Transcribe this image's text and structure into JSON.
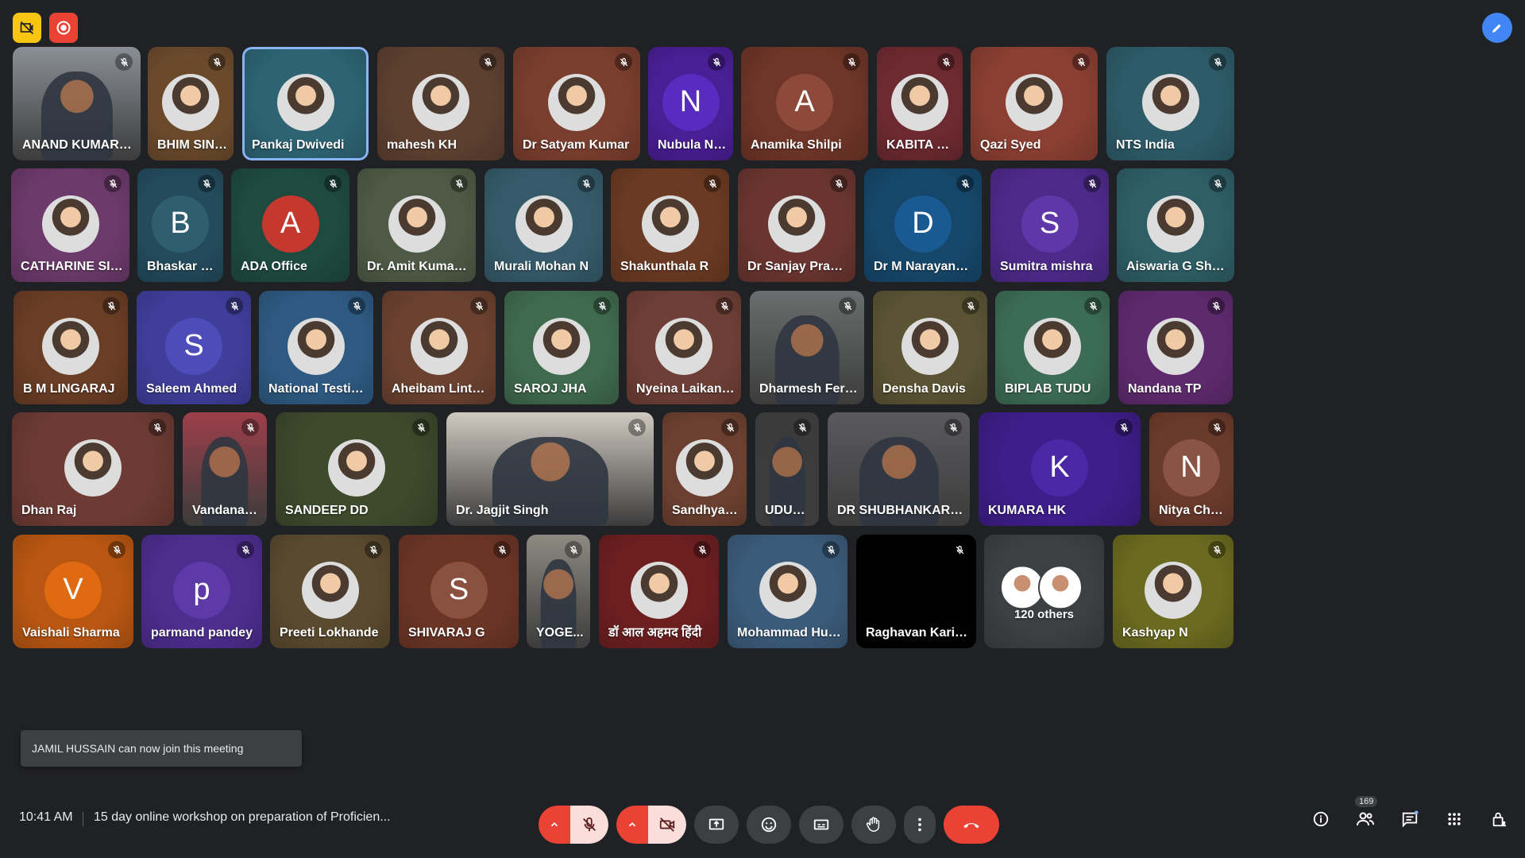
{
  "participants": [
    {
      "name": "ANAND KUMAR SAU...",
      "initial": "",
      "bg": "#8a8f96",
      "avatar": "photo-video",
      "muted": true
    },
    {
      "name": "BHIM SINGH",
      "initial": "",
      "bg": "#6b4a2c",
      "avatar": "photo",
      "muted": true
    },
    {
      "name": "Pankaj Dwivedi",
      "initial": "",
      "bg": "#2d6373",
      "avatar": "photo",
      "muted": false,
      "active": true
    },
    {
      "name": "mahesh KH",
      "initial": "",
      "bg": "#5d4030",
      "avatar": "photo",
      "muted": true
    },
    {
      "name": "Dr Satyam Kumar",
      "initial": "",
      "bg": "#7a3e2e",
      "avatar": "photo",
      "muted": true
    },
    {
      "name": "Nubula Nau...",
      "initial": "N",
      "bg": "#4a1e94",
      "avatarColor": "#5a2bbf",
      "muted": true
    },
    {
      "name": "Anamika Shilpi",
      "initial": "A",
      "bg": "#6e3528",
      "avatarColor": "#8d4a3a",
      "muted": true
    },
    {
      "name": "KABITA BA...",
      "initial": "",
      "bg": "#6d2a30",
      "avatar": "photo",
      "muted": true
    },
    {
      "name": "Qazi Syed",
      "initial": "",
      "bg": "#8b3f32",
      "avatar": "photo",
      "muted": true
    },
    {
      "name": "NTS India",
      "initial": "",
      "bg": "#2d5b68",
      "avatar": "photo",
      "muted": true
    },
    {
      "name": "CATHARINE SIBY",
      "initial": "",
      "bg": "#6c3a6b",
      "avatar": "photo",
      "muted": true
    },
    {
      "name": "Bhaskar Sin...",
      "initial": "B",
      "bg": "#234b5c",
      "avatarColor": "#2f5e70",
      "muted": true
    },
    {
      "name": "ADA Office",
      "initial": "A",
      "bg": "#1e4a40",
      "avatarColor": "#c5382e",
      "muted": true
    },
    {
      "name": "Dr. Amit Kumar Jha",
      "initial": "",
      "bg": "#4e5a45",
      "avatar": "photo",
      "muted": true
    },
    {
      "name": "Murali Mohan N",
      "initial": "",
      "bg": "#355b6a",
      "avatar": "photo",
      "muted": true
    },
    {
      "name": "Shakunthala R",
      "initial": "",
      "bg": "#6b3a22",
      "avatar": "photo",
      "muted": true
    },
    {
      "name": "Dr Sanjay Prasad S...",
      "initial": "",
      "bg": "#6a3530",
      "avatar": "photo",
      "muted": true
    },
    {
      "name": "Dr M Narayana Re...",
      "initial": "D",
      "bg": "#16476a",
      "avatarColor": "#1a5a92",
      "muted": true
    },
    {
      "name": "Sumitra mishra",
      "initial": "S",
      "bg": "#4d2a8a",
      "avatarColor": "#5f37a8",
      "muted": true
    },
    {
      "name": "Aiswaria G Shajan",
      "initial": "",
      "bg": "#2e5e66",
      "avatar": "photo",
      "muted": true
    },
    {
      "name": "B M LINGARAJ",
      "initial": "",
      "bg": "#6a3d25",
      "avatar": "photo",
      "muted": true
    },
    {
      "name": "Saleem Ahmed",
      "initial": "S",
      "bg": "#3f3e9a",
      "avatarColor": "#4d4cb8",
      "muted": true
    },
    {
      "name": "National Testing S...",
      "initial": "",
      "bg": "#2e5a82",
      "avatar": "photo",
      "muted": true
    },
    {
      "name": "Aheibam Linthoin...",
      "initial": "",
      "bg": "#6b4130",
      "avatar": "photo",
      "muted": true
    },
    {
      "name": "SAROJ JHA",
      "initial": "",
      "bg": "#3f6a4d",
      "avatar": "photo",
      "muted": true
    },
    {
      "name": "Nyeina Laikangba...",
      "initial": "",
      "bg": "#6e3f36",
      "avatar": "photo",
      "muted": true
    },
    {
      "name": "Dharmesh Fernan...",
      "initial": "",
      "bg": "#6b6e6e",
      "avatar": "photo-video",
      "muted": true
    },
    {
      "name": "Densha Davis",
      "initial": "",
      "bg": "#5a5434",
      "avatar": "photo",
      "muted": true
    },
    {
      "name": "BIPLAB TUDU",
      "initial": "",
      "bg": "#3c6c55",
      "avatar": "photo",
      "muted": true
    },
    {
      "name": "Nandana TP",
      "initial": "",
      "bg": "#5e2a6e",
      "avatar": "photo",
      "muted": true
    },
    {
      "name": "Dhan Raj",
      "initial": "",
      "bg": "#6e3b34",
      "avatar": "photo",
      "muted": true
    },
    {
      "name": "Vandana Si...",
      "initial": "",
      "bg": "#9d3f4a",
      "avatar": "photo-video",
      "muted": true
    },
    {
      "name": "SANDEEP DD",
      "initial": "",
      "bg": "#3e4a2c",
      "avatar": "photo",
      "muted": true
    },
    {
      "name": "Dr. Jagjit Singh",
      "initial": "",
      "bg": "#cfc9c0",
      "avatar": "photo-video",
      "muted": true
    },
    {
      "name": "Sandhya H.S",
      "initial": "",
      "bg": "#6b4030",
      "avatar": "photo",
      "muted": true
    },
    {
      "name": "UDUM...",
      "initial": "",
      "bg": "#3b3b3b",
      "avatar": "photo-video",
      "muted": true
    },
    {
      "name": "DR SHUBHANKAR MISH...",
      "initial": "",
      "bg": "#5a5a5e",
      "avatar": "photo-video",
      "muted": true
    },
    {
      "name": "KUMARA HK",
      "initial": "K",
      "bg": "#3e1e8a",
      "avatarColor": "#4a28a6",
      "muted": true
    },
    {
      "name": "Nitya Chetry",
      "initial": "N",
      "bg": "#6a3a2c",
      "avatarColor": "#8a5444",
      "muted": true
    },
    {
      "name": "Vaishali Sharma",
      "initial": "V",
      "bg": "#b85612",
      "avatarColor": "#e06a12",
      "muted": true
    },
    {
      "name": "parmand pandey",
      "initial": "p",
      "bg": "#4d2d8e",
      "avatarColor": "#5e3aa9",
      "muted": true
    },
    {
      "name": "Preeti Lokhande",
      "initial": "",
      "bg": "#5a4a2f",
      "avatar": "photo",
      "muted": true
    },
    {
      "name": "SHIVARAJ G",
      "initial": "S",
      "bg": "#6b3526",
      "avatarColor": "#8a5040",
      "muted": true
    },
    {
      "name": "YOGE...",
      "initial": "",
      "bg": "#8d8a82",
      "avatar": "photo-video",
      "muted": true
    },
    {
      "name": "डॉ आल अहमद हिंदी",
      "initial": "",
      "bg": "#6d1f20",
      "avatar": "photo",
      "muted": true
    },
    {
      "name": "Mohammad Hussa...",
      "initial": "",
      "bg": "#3b5b7a",
      "avatar": "photo",
      "muted": true
    },
    {
      "name": "Raghavan Karigha...",
      "initial": "",
      "bg": "#000000",
      "avatar": "none",
      "muted": true
    },
    {
      "name": "120 others",
      "initial": "",
      "bg": "#3c4043",
      "avatar": "others",
      "muted": false
    },
    {
      "name": "Kashyap N",
      "initial": "",
      "bg": "#6a6a20",
      "avatar": "photo",
      "muted": true
    }
  ],
  "toast": "JAMIL HUSSAIN can now join this meeting",
  "bottom": {
    "time": "10:41 AM",
    "separator": "|",
    "meeting_title": "15 day online workshop on preparation of Proficien...",
    "people_count": "169"
  },
  "colors": {
    "background": "#202124",
    "end_call": "#ea4335",
    "muted_control": "#f9dedc",
    "accent": "#4285f4"
  }
}
